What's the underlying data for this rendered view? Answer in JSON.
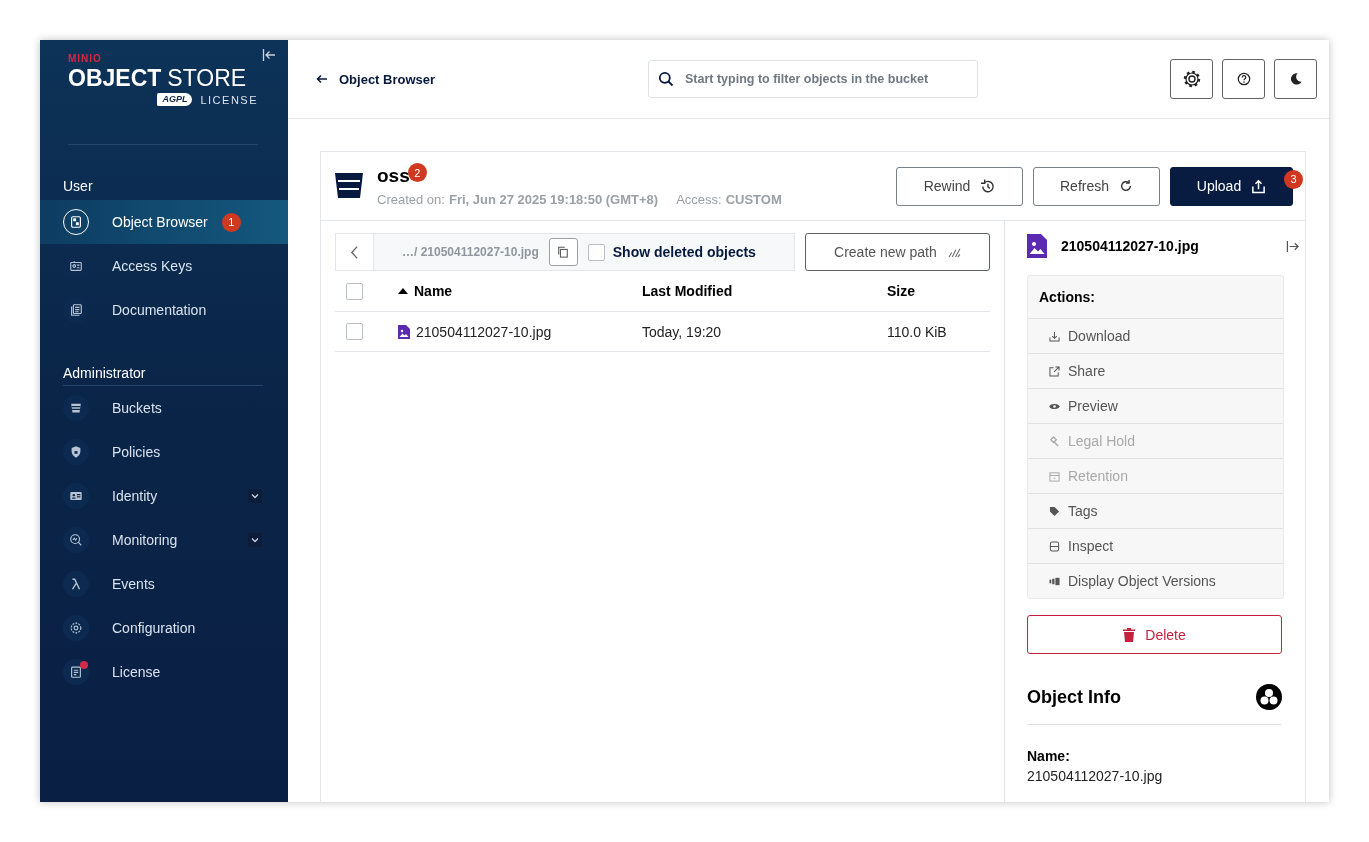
{
  "sidebar": {
    "logo": {
      "brand": "MINIO",
      "title_bold": "OBJECT",
      "title_light": "STORE",
      "license_mark": "AGPL",
      "license": "LICENSE"
    },
    "sections": [
      {
        "title": "User",
        "items": [
          {
            "label": "Object Browser",
            "selected": true,
            "badge": "1",
            "expandable": false,
            "notification": false
          },
          {
            "label": "Access Keys",
            "selected": false,
            "expandable": false,
            "notification": false
          },
          {
            "label": "Documentation",
            "selected": false,
            "expandable": false,
            "notification": false
          }
        ]
      },
      {
        "title": "Administrator",
        "items": [
          {
            "label": "Buckets",
            "selected": false,
            "expandable": false,
            "notification": false
          },
          {
            "label": "Policies",
            "selected": false,
            "expandable": false,
            "notification": false
          },
          {
            "label": "Identity",
            "selected": false,
            "expandable": true,
            "notification": false
          },
          {
            "label": "Monitoring",
            "selected": false,
            "expandable": true,
            "notification": false
          },
          {
            "label": "Events",
            "selected": false,
            "expandable": false,
            "notification": false
          },
          {
            "label": "Configuration",
            "selected": false,
            "expandable": false,
            "notification": false
          },
          {
            "label": "License",
            "selected": false,
            "expandable": false,
            "notification": true
          }
        ]
      }
    ]
  },
  "header": {
    "back_link": "Object Browser",
    "search": {
      "placeholder": "Start typing to filter objects in the bucket"
    }
  },
  "bucket": {
    "name": "oss",
    "badge": "2",
    "created_label": "Created on:",
    "created_value": "Fri, Jun 27 2025 19:18:50 (GMT+8)",
    "access_label": "Access:",
    "access_value": "CUSTOM",
    "buttons": [
      {
        "label": "Rewind",
        "kind": "rewind"
      },
      {
        "label": "Refresh",
        "kind": "refresh"
      },
      {
        "label": "Upload",
        "kind": "upload",
        "badge": "3"
      }
    ]
  },
  "browser": {
    "path": "…/ 210504112027-10.jpg",
    "show_deleted": {
      "label": "Show deleted objects",
      "checked": false
    },
    "create_path": "Create new path",
    "table": {
      "select_all_checked": false,
      "columns": [
        {
          "label": "Name",
          "sorted": true
        },
        {
          "label": "Last Modified",
          "sorted": false
        },
        {
          "label": "Size",
          "sorted": false
        }
      ],
      "rows": [
        {
          "checked": false,
          "name": "210504112027-10.jpg",
          "last_modified": "Today, 19:20",
          "size": "110.0 KiB"
        }
      ]
    }
  },
  "details": {
    "filename": "210504112027-10.jpg",
    "actions_title": "Actions:",
    "actions": [
      {
        "label": "Download",
        "disabled": false
      },
      {
        "label": "Share",
        "disabled": false
      },
      {
        "label": "Preview",
        "disabled": false
      },
      {
        "label": "Legal Hold",
        "disabled": true
      },
      {
        "label": "Retention",
        "disabled": true
      },
      {
        "label": "Tags",
        "disabled": false
      },
      {
        "label": "Inspect",
        "disabled": false
      },
      {
        "label": "Display Object Versions",
        "disabled": false
      }
    ],
    "delete": "Delete",
    "info_title": "Object Info",
    "fields": [
      {
        "label": "Name:",
        "value": "210504112027-10.jpg"
      }
    ]
  }
}
